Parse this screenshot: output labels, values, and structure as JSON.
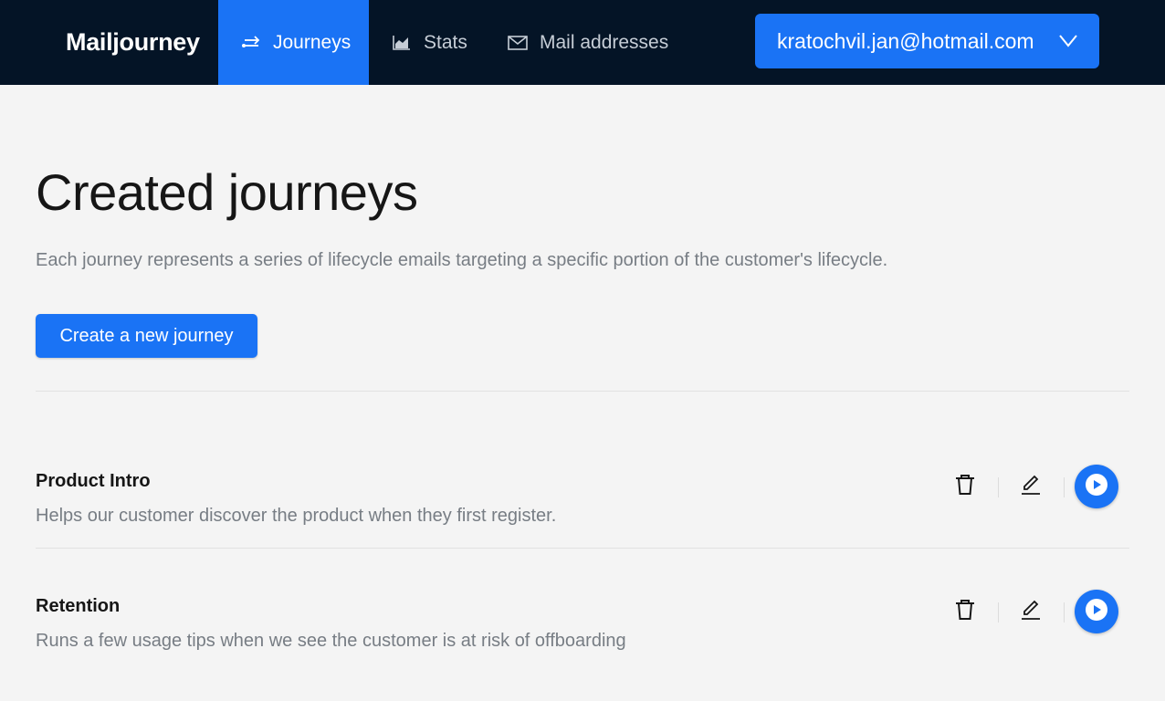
{
  "header": {
    "brand": "Mailjourney",
    "nav": [
      {
        "label": "Journeys",
        "icon": "journeys-icon",
        "active": true
      },
      {
        "label": "Stats",
        "icon": "chart-icon",
        "active": false
      },
      {
        "label": "Mail addresses",
        "icon": "mail-icon",
        "active": false
      }
    ],
    "account": {
      "email": "kratochvil.jan@hotmail.com",
      "icon": "chevron-down-icon"
    }
  },
  "main": {
    "title": "Created journeys",
    "subtitle": "Each journey represents a series of lifecycle emails targeting a specific portion of the customer's lifecycle.",
    "create_label": "Create a new journey",
    "journeys": [
      {
        "name": "Product Intro",
        "description": "Helps our customer discover the product when they first register."
      },
      {
        "name": "Retention",
        "description": "Runs a few usage tips when we see the customer is at risk of offboarding"
      }
    ],
    "actions": [
      "trash-icon",
      "edit-icon",
      "play-icon"
    ]
  },
  "colors": {
    "topbar": "#041426",
    "accent": "#1a73f5",
    "background": "#f4f4f4",
    "muted_text": "#777d84"
  }
}
